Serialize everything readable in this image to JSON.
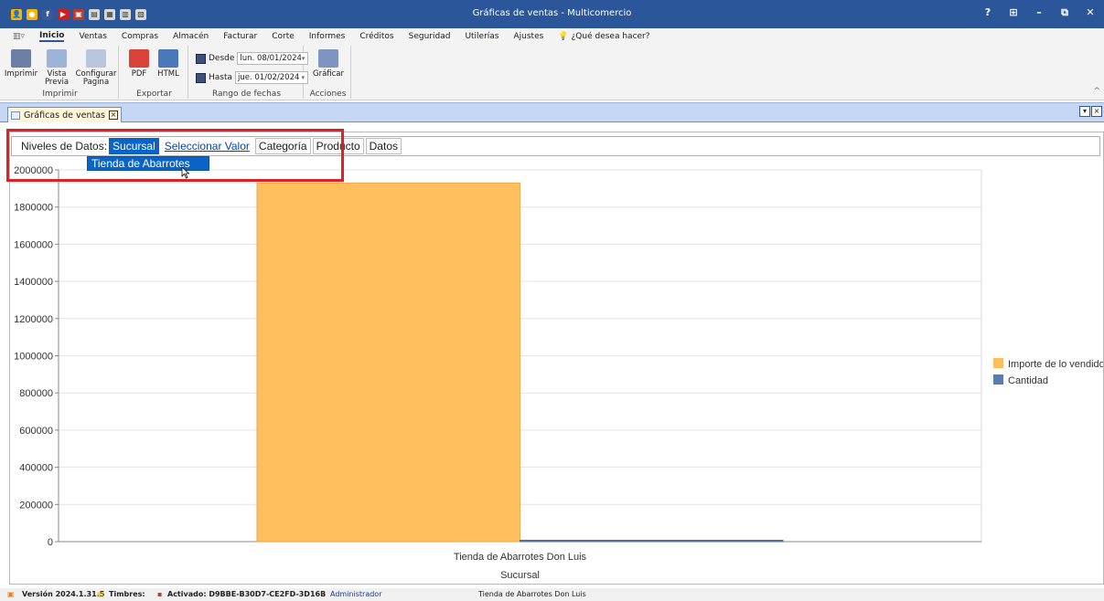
{
  "window": {
    "title": "Gráficas de ventas - Multicomercio",
    "controls": [
      "?",
      "⊞",
      "–",
      "⧉",
      "✕"
    ]
  },
  "quick_access_icons": [
    "user-icon",
    "facebook-icon",
    "youtube-icon",
    "save-icon",
    "print-icon",
    "calendar-icon"
  ],
  "menu": {
    "items": [
      "Inicio",
      "Ventas",
      "Compras",
      "Almacén",
      "Facturar",
      "Corte",
      "Informes",
      "Créditos",
      "Seguridad",
      "Utilerías",
      "Ajustes"
    ],
    "active": "Inicio",
    "tell_me": "¿Qué desea hacer?"
  },
  "ribbon": {
    "groups": {
      "imprimir": {
        "label": "Imprimir",
        "buttons": [
          "Imprimir",
          "Vista Previa",
          "Configurar Pagina"
        ]
      },
      "exportar": {
        "label": "Exportar",
        "buttons": [
          "PDF",
          "HTML"
        ]
      },
      "rango": {
        "label": "Rango de fechas",
        "desde_label": "Desde",
        "desde_value": "lun. 08/01/2024",
        "hasta_label": "Hasta",
        "hasta_value": "jue. 01/02/2024"
      },
      "acciones": {
        "label": "Acciones",
        "graficar": "Gráficar"
      }
    }
  },
  "doc_tab": {
    "label": "Gráficas de ventas"
  },
  "levels": {
    "label": "Niveles de Datos:",
    "items": [
      "Sucursal",
      "Seleccionar Valor",
      "Categoría",
      "Producto",
      "Datos"
    ],
    "selected": "Sucursal",
    "dropdown_value": "Tienda de Abarrotes Don Luis"
  },
  "chart_data": {
    "type": "bar",
    "categories": [
      "Tienda de Abarrotes Don Luis"
    ],
    "series": [
      {
        "name": "Importe de lo vendido",
        "values": [
          1930000
        ],
        "color": "#ffbf5e"
      },
      {
        "name": "Cantidad",
        "values": [
          8000
        ],
        "color": "#5b7cb1"
      }
    ],
    "xlabel": "Sucursal",
    "ylabel": "",
    "ylim": [
      0,
      2000000
    ],
    "yticks": [
      "0",
      "200000",
      "400000",
      "600000",
      "800000",
      "1000000",
      "1200000",
      "1400000",
      "1600000",
      "1800000",
      "2000000"
    ],
    "grid": true,
    "legend": "right"
  },
  "status": {
    "version": "Versión 2024.1.31.5",
    "timbres": "Timbres:",
    "activado": "Activado: D9BBE-B30D7-CE2FD-3D16B",
    "usuario": "Administrador",
    "sucursal": "Tienda de Abarrotes Don Luis"
  }
}
